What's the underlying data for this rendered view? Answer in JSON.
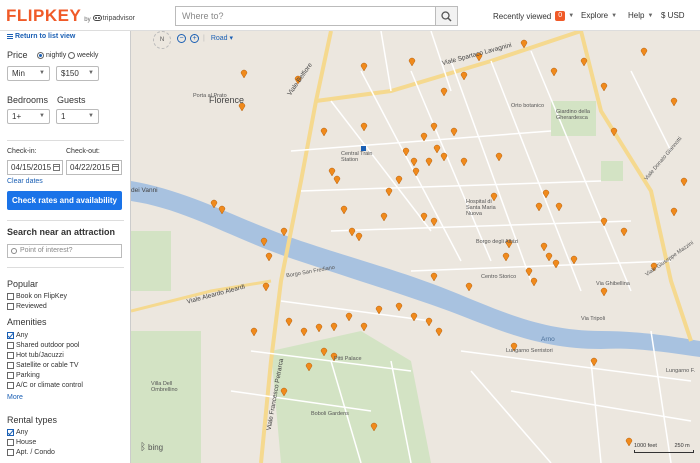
{
  "header": {
    "logo": "FLIPKEY",
    "logo_by": "by",
    "logo_partner": "tripadvisor",
    "search_placeholder": "Where to?",
    "nav_recently": "Recently viewed",
    "nav_recent_count": "0",
    "nav_explore": "Explore",
    "nav_help": "Help",
    "nav_currency": "$ USD"
  },
  "sidebar": {
    "return_link": "Return to list view",
    "price_label": "Price",
    "price_nightly": "nightly",
    "price_weekly": "weekly",
    "price_min": "Min",
    "price_max": "$150",
    "bedrooms_label": "Bedrooms",
    "bedrooms_value": "1+",
    "guests_label": "Guests",
    "guests_value": "1",
    "checkin_label": "Check-in:",
    "checkin_value": "04/15/2015",
    "checkout_label": "Check-out:",
    "checkout_value": "04/22/2015",
    "clear_dates": "Clear dates",
    "check_rates_button": "Check rates and availability",
    "search_attraction_heading": "Search near an attraction",
    "poi_placeholder": "Point of interest?",
    "popular_heading": "Popular",
    "popular_items": [
      "Book on FlipKey",
      "Reviewed"
    ],
    "amenities_heading": "Amenities",
    "amenities_items": [
      "Any",
      "Shared outdoor pool",
      "Hot tub/Jacuzzi",
      "Satellite or cable TV",
      "Parking",
      "A/C or climate control"
    ],
    "more_link": "More",
    "rental_types_heading": "Rental types",
    "rental_items": [
      "Any",
      "House",
      "Apt. / Condo"
    ]
  },
  "map": {
    "compass": "N",
    "road_label": "Road",
    "bing": "bing",
    "scale_left": "1000 feet",
    "scale_right": "250 m",
    "labels": {
      "florence": "Florence",
      "viale_belfiore": "Viale Belfiore",
      "viale_lavagnini": "Viale Spartaco Lavagnini",
      "santa_maria_novella": "Central Train Station",
      "porta_al_prato": "Porta al Prato",
      "arno": "Arno",
      "viale_petrarca": "Viale Francesco Petrarca",
      "viale_aleardi": "Viale Aleardo Aleardi",
      "boboli": "Boboli Gardens",
      "pitti": "Pitti Palace",
      "santa_maria_nuova": "Santa Maria Nuova",
      "via_dei_vanni": "dei Vanni",
      "orto_botanico": "Orto botanico",
      "giardino_gherardesca": "Giardino della Gherardesca",
      "lungarno_serristori": "Lungarno Serristori",
      "lungarno_ferrucci": "Lungarno F.",
      "via_tripoli": "Via Tripoli",
      "borgo_albizi": "Borgo degli Albizi",
      "borgo_frediano": "Borgo San Frediano",
      "villa_ombrellino": "Villa Dell Ombrellino",
      "viale_giannotti": "Viale Donato Giannotti",
      "via_ghibellina": "Via Ghibellina",
      "viale_mazzini": "Viale Giuseppe Mazzini",
      "centro_storico": "Centro Storico",
      "hospital": "Hospital di Santa Maria Nuova"
    }
  },
  "colors": {
    "brand": "#f05a28",
    "primary_button": "#1a73e8",
    "link": "#1a5fb4",
    "river": "#a8c2e0",
    "pin": "#f08a1c"
  }
}
